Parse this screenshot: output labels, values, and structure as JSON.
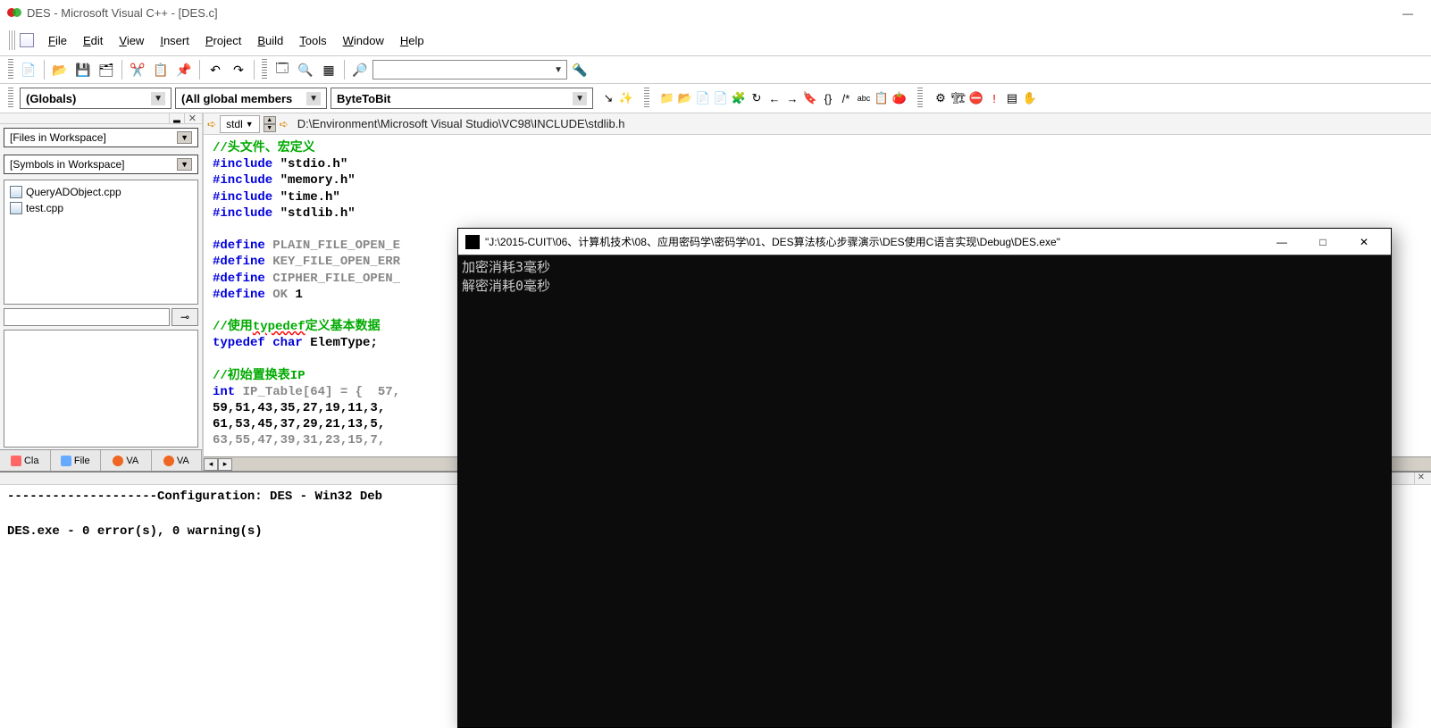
{
  "title": "DES - Microsoft Visual C++ - [DES.c]",
  "menu": [
    "File",
    "Edit",
    "View",
    "Insert",
    "Project",
    "Build",
    "Tools",
    "Window",
    "Help"
  ],
  "menu_accel": [
    "F",
    "E",
    "V",
    "I",
    "P",
    "B",
    "T",
    "W",
    "H"
  ],
  "toolbar1": {
    "search_placeholder": ""
  },
  "toolbar2": {
    "scope": "(Globals)",
    "members": "(All global members",
    "func": "ByteToBit"
  },
  "sidebar": {
    "combo1": "[Files in Workspace]",
    "combo2": "[Symbols in Workspace]",
    "files": [
      "QueryADObject.cpp",
      "test.cpp"
    ],
    "tabs": [
      "Cla",
      "File",
      "VA",
      "VA"
    ]
  },
  "editor": {
    "tab": "stdl",
    "path": "D:\\Environment\\Microsoft Visual Studio\\VC98\\INCLUDE\\stdlib.h",
    "code": {
      "l1": "//头文件、宏定义",
      "l2a": "#include",
      "l2b": "\"stdio.h\"",
      "l3a": "#include",
      "l3b": "\"memory.h\"",
      "l4a": "#include",
      "l4b": "\"time.h\"",
      "l5a": "#include",
      "l5b": "\"stdlib.h\"",
      "l7a": "#define",
      "l7b": "PLAIN_FILE_OPEN_E",
      "l8a": "#define",
      "l8b": "KEY_FILE_OPEN_ERR",
      "l9a": "#define",
      "l9b": "CIPHER_FILE_OPEN_",
      "l10a": "#define",
      "l10b": "OK",
      "l10c": "1",
      "l12": "//使用typedef定义基本数据",
      "l12a": "//使用",
      "l12b": "typedef",
      "l12c": "定义基本数据",
      "l13a": "typedef",
      "l13b": "char",
      "l13c": "ElemType;",
      "l15": "//初始置换表IP",
      "l16a": "int",
      "l16b": "IP_Table[64] = {  57,",
      "l17": "59,51,43,35,27,19,11,3,",
      "l18": "61,53,45,37,29,21,13,5,",
      "l19": "63,55,47,39,31,23,15,7,"
    }
  },
  "output": {
    "header": "--------------------Configuration: DES - Win32 Deb",
    "result": "DES.exe - 0 error(s), 0 warning(s)"
  },
  "console": {
    "title": "\"J:\\2015-CUIT\\06、计算机技术\\08、应用密码学\\密码学\\01、DES算法核心步骤演示\\DES使用C语言实现\\Debug\\DES.exe\"",
    "line1": "加密消耗3毫秒",
    "line2": "解密消耗0毫秒"
  }
}
